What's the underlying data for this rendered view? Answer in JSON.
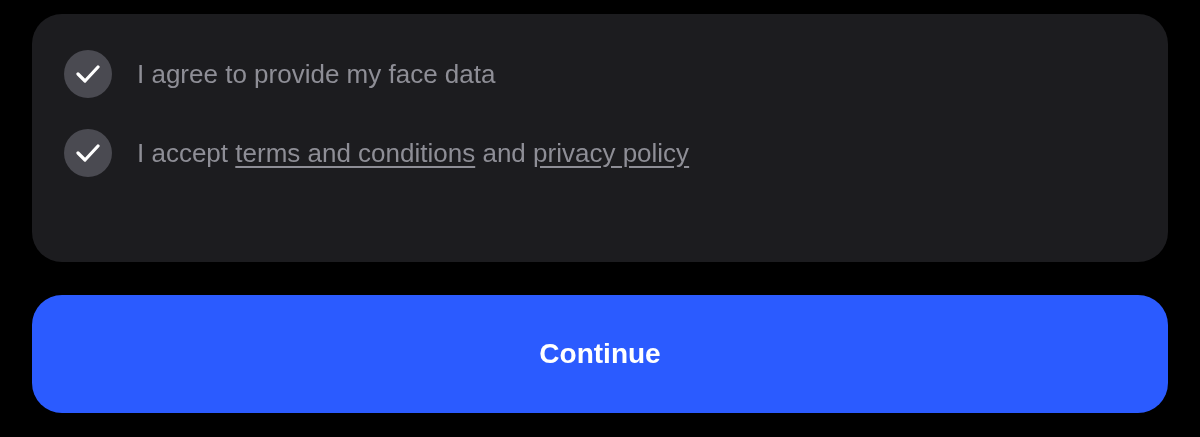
{
  "consents": [
    {
      "checked": true,
      "parts": [
        {
          "kind": "text",
          "text": "I agree to provide my face data"
        }
      ]
    },
    {
      "checked": true,
      "parts": [
        {
          "kind": "text",
          "text": "I accept"
        },
        {
          "kind": "link",
          "text": "terms and conditions"
        },
        {
          "kind": "text",
          "text": "and"
        },
        {
          "kind": "link",
          "text": "privacy policy"
        }
      ]
    }
  ],
  "button": {
    "label": "Continue"
  }
}
